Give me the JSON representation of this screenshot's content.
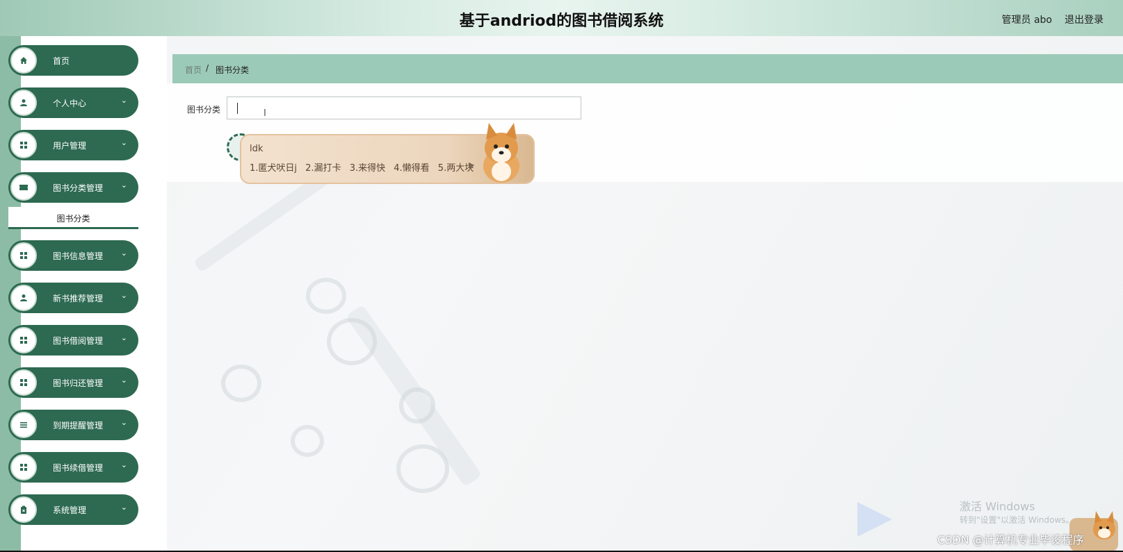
{
  "header": {
    "title": "基于andriod的图书借阅系统",
    "admin_label": "管理员 abo",
    "logout_label": "退出登录"
  },
  "sidebar": {
    "items": [
      {
        "label": "首页",
        "icon": "home-icon",
        "has_chevron": false
      },
      {
        "label": "个人中心",
        "icon": "user-icon",
        "has_chevron": true
      },
      {
        "label": "用户管理",
        "icon": "grid-icon",
        "has_chevron": true
      },
      {
        "label": "图书分类管理",
        "icon": "ticket-icon",
        "has_chevron": true,
        "expanded": true
      },
      {
        "label": "图书信息管理",
        "icon": "grid-icon",
        "has_chevron": true
      },
      {
        "label": "新书推荐管理",
        "icon": "user-icon",
        "has_chevron": true
      },
      {
        "label": "图书借阅管理",
        "icon": "grid-icon",
        "has_chevron": true
      },
      {
        "label": "图书归还管理",
        "icon": "grid-icon",
        "has_chevron": true
      },
      {
        "label": "到期提醒管理",
        "icon": "list-icon",
        "has_chevron": true
      },
      {
        "label": "图书续借管理",
        "icon": "grid-icon",
        "has_chevron": true
      },
      {
        "label": "系统管理",
        "icon": "clipboard-icon",
        "has_chevron": true
      }
    ],
    "submenu": {
      "label": "图书分类"
    }
  },
  "breadcrumb": {
    "home": "首页",
    "separator": "/",
    "current": "图书分类"
  },
  "form": {
    "field_label": "图书分类",
    "field_value": "",
    "field_placeholder": ""
  },
  "ime": {
    "composition": "ldk",
    "candidates": [
      "1.匿犬吠日j",
      "2.漏打卡",
      "3.来得快",
      "4.懒得看",
      "5.两大块"
    ]
  },
  "watermark": {
    "line1": "激活 Windows",
    "line2": "转到\"设置\"以激活 Windows。",
    "csdn": "CSDN @计算机专业毕设程序"
  },
  "colors": {
    "primary": "#2d6a51",
    "header_start": "#9fc9b6",
    "breadcrumb_bg": "#9ccab8",
    "stripe": "#8cbca5"
  }
}
